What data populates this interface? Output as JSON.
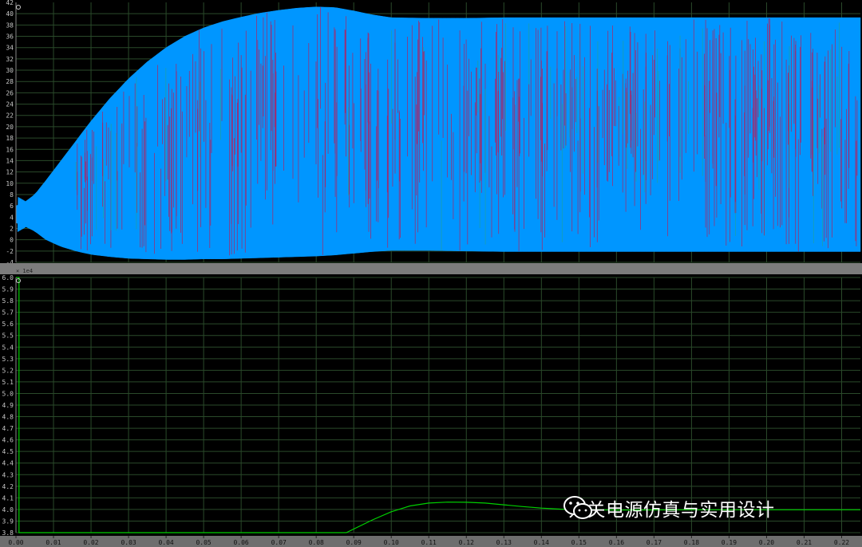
{
  "chart_data": [
    {
      "type": "line",
      "title": "",
      "xlabel": "",
      "ylabel": "",
      "xlim": [
        0,
        0.225
      ],
      "ylim": [
        -4,
        42
      ],
      "y_ticks": [
        -4,
        -2,
        0,
        2,
        4,
        6,
        8,
        10,
        12,
        14,
        16,
        18,
        20,
        22,
        24,
        26,
        28,
        30,
        32,
        34,
        36,
        38,
        40
      ],
      "grid": true,
      "series": [
        {
          "color": "#0096ff",
          "upper_envelope": {
            "x": [
              0,
              0.002,
              0.005,
              0.008,
              0.012,
              0.016,
              0.02,
              0.025,
              0.03,
              0.035,
              0.04,
              0.045,
              0.05,
              0.055,
              0.06,
              0.065,
              0.07,
              0.075,
              0.08,
              0.085,
              0.09,
              0.095,
              0.1,
              0.11,
              0.12,
              0.13,
              0.14,
              0.16,
              0.18,
              0.2,
              0.225
            ],
            "y": [
              6,
              6.5,
              8,
              10.5,
              14,
              17.5,
              21,
              25,
              28.5,
              31.5,
              34,
              36,
              37.5,
              38.6,
              39.4,
              40.1,
              40.6,
              41.0,
              41.2,
              41.1,
              40.5,
              39.8,
              39.3,
              39.2,
              39.2,
              39.3,
              39.3,
              39.3,
              39.3,
              39.3,
              39.3
            ]
          },
          "lower_envelope": {
            "x": [
              0,
              0.002,
              0.005,
              0.008,
              0.012,
              0.016,
              0.02,
              0.025,
              0.03,
              0.035,
              0.04,
              0.045,
              0.05,
              0.055,
              0.06,
              0.065,
              0.07,
              0.075,
              0.08,
              0.085,
              0.09,
              0.095,
              0.1,
              0.11,
              0.12,
              0.13,
              0.14,
              0.16,
              0.18,
              0.2,
              0.225
            ],
            "y": [
              3,
              2.5,
              1.5,
              0,
              -1.2,
              -2,
              -2.6,
              -3,
              -3.3,
              -3.4,
              -3.5,
              -3.5,
              -3.4,
              -3.4,
              -3.3,
              -3.2,
              -3.1,
              -3.0,
              -2.9,
              -2.7,
              -2.4,
              -2.1,
              -1.9,
              -1.9,
              -2.0,
              -2.1,
              -2.1,
              -2.1,
              -2.1,
              -2.1,
              -2.1
            ]
          }
        }
      ]
    },
    {
      "type": "line",
      "title": "",
      "xlabel": "",
      "ylabel": "",
      "y_multiplier": "1e4",
      "xlim": [
        0,
        0.225
      ],
      "ylim": [
        3.8,
        6.0
      ],
      "x_ticks": [
        "0.00",
        "0.01",
        "0.02",
        "0.03",
        "0.04",
        "0.05",
        "0.06",
        "0.07",
        "0.08",
        "0.09",
        "0.10",
        "0.11",
        "0.12",
        "0.13",
        "0.14",
        "0.15",
        "0.16",
        "0.17",
        "0.18",
        "0.19",
        "0.20",
        "0.21",
        "0.22"
      ],
      "y_ticks": [
        "3.8",
        "3.9",
        "4.0",
        "4.1",
        "4.2",
        "4.3",
        "4.4",
        "4.5",
        "4.6",
        "4.7",
        "4.8",
        "4.9",
        "5.0",
        "5.1",
        "5.2",
        "5.3",
        "5.4",
        "5.5",
        "5.6",
        "5.7",
        "5.8",
        "5.9",
        "6.0"
      ],
      "grid": true,
      "series": [
        {
          "color": "#00d000",
          "x": [
            0,
            0.0008,
            0.0008,
            0.088,
            0.095,
            0.1,
            0.105,
            0.11,
            0.115,
            0.12,
            0.125,
            0.13,
            0.135,
            0.14,
            0.145,
            0.15,
            0.16,
            0.17,
            0.18,
            0.2,
            0.225
          ],
          "y": [
            6.0,
            6.0,
            3.8,
            3.8,
            3.91,
            3.98,
            4.03,
            4.055,
            4.063,
            4.062,
            4.055,
            4.04,
            4.025,
            4.012,
            4.003,
            3.998,
            3.995,
            3.996,
            3.997,
            3.997,
            3.997
          ]
        }
      ]
    }
  ],
  "plot1": {
    "y_ticks": [
      "-4",
      "-2",
      "0",
      "2",
      "4",
      "6",
      "8",
      "10",
      "12",
      "14",
      "16",
      "18",
      "20",
      "22",
      "24",
      "26",
      "28",
      "30",
      "32",
      "34",
      "36",
      "38",
      "40",
      "42"
    ]
  },
  "plot2": {
    "exponent_label": "× 1e4"
  },
  "watermark": {
    "text": "开关电源仿真与实用设计",
    "icon": "wechat-icon"
  },
  "colors": {
    "background": "#000000",
    "grid": "#2a4a2a",
    "signal_top": "#0096ff",
    "signal_top_spikes": "#b02060",
    "signal_bottom": "#00d000",
    "axis_bar": "#7c7c7c"
  }
}
